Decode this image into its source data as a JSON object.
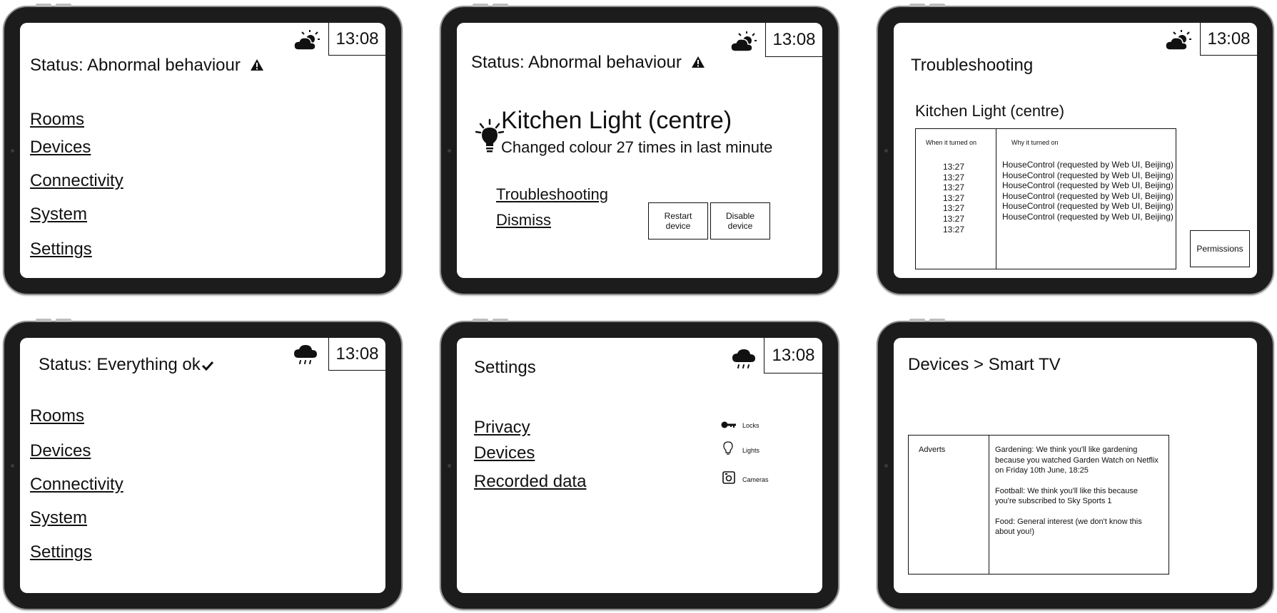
{
  "clock": "13:08",
  "screen1": {
    "status": "Status: Abnormal behaviour",
    "nav": [
      "Rooms",
      "Devices",
      "Connectivity",
      "System",
      "Settings"
    ],
    "weather_icon": "partly-cloudy-icon",
    "status_icon": "warning-icon"
  },
  "screen2": {
    "status": "Status: Abnormal behaviour",
    "device_name": "Kitchen Light (centre)",
    "device_message": "Changed colour 27 times in last minute",
    "links": [
      "Troubleshooting",
      "Dismiss"
    ],
    "restart_label": "Restart device",
    "disable_label": "Disable device",
    "device_icon": "light-bulb-icon"
  },
  "screen3": {
    "title": "Troubleshooting",
    "device_name": "Kitchen Light (centre)",
    "table_headers": [
      "When it turned on",
      "Why it turned on"
    ],
    "times": [
      "13:27",
      "13:27",
      "13:27",
      "13:27",
      "13:27",
      "13:27",
      "13:27"
    ],
    "reasons": [
      "HouseControl (requested by Web UI, Beijing)",
      "HouseControl (requested by Web UI, Beijing)",
      "HouseControl (requested by Web UI, Beijing)",
      "HouseControl (requested by Web UI, Beijing)",
      "HouseControl (requested by Web UI, Beijing)",
      "HouseControl (requested by Web UI, Beijing)"
    ],
    "permissions_label": "Permissions"
  },
  "screen4": {
    "status": "Status: Everything ok",
    "nav": [
      "Rooms",
      "Devices",
      "Connectivity",
      "System",
      "Settings"
    ],
    "weather_icon": "rain-cloud-icon",
    "status_icon": "checkmark-icon"
  },
  "screen5": {
    "title": "Settings",
    "links": [
      "Privacy",
      "Devices",
      "Recorded data"
    ],
    "devices": [
      {
        "label": "Locks",
        "icon": "key-icon"
      },
      {
        "label": "Lights",
        "icon": "light-bulb-icon"
      },
      {
        "label": "Cameras",
        "icon": "camera-icon"
      }
    ],
    "weather_icon": "rain-cloud-icon"
  },
  "screen6": {
    "breadcrumb": "Devices > Smart TV",
    "category": "Adverts",
    "ads": [
      "Gardening: We think you'll like gardening because you watched Garden Watch on Netflix on Friday 10th June, 18:25",
      "Football: We think you'll like this because you're subscribed to Sky Sports 1",
      "Food: General interest (we don't know this about you!)"
    ]
  }
}
